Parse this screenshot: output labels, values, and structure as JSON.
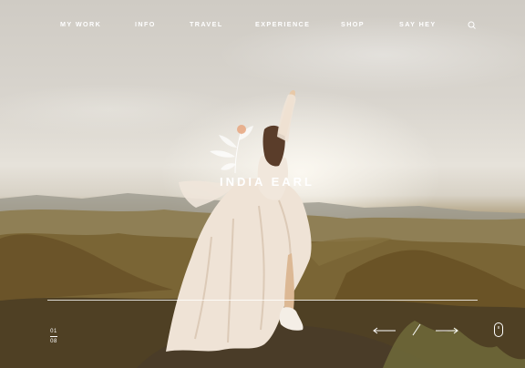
{
  "nav": {
    "items": [
      {
        "label": "MY WORK"
      },
      {
        "label": "INFO"
      },
      {
        "label": "TRAVEL"
      },
      {
        "label": "EXPERIENCE"
      },
      {
        "label": "SHOP"
      },
      {
        "label": "SAY HEY"
      }
    ],
    "search_icon": "search-icon"
  },
  "logo": {
    "text": "INDIA EARL",
    "mark_icon": "botanical-leaf-icon"
  },
  "slider": {
    "current": "01",
    "total": "08",
    "prev_icon": "arrow-left-icon",
    "next_icon": "arrow-right-icon"
  },
  "scroll_icon": "mouse-scroll-icon",
  "colors": {
    "text": "#ffffff",
    "dress": "#efe3d6",
    "hills": "#7a6535"
  }
}
